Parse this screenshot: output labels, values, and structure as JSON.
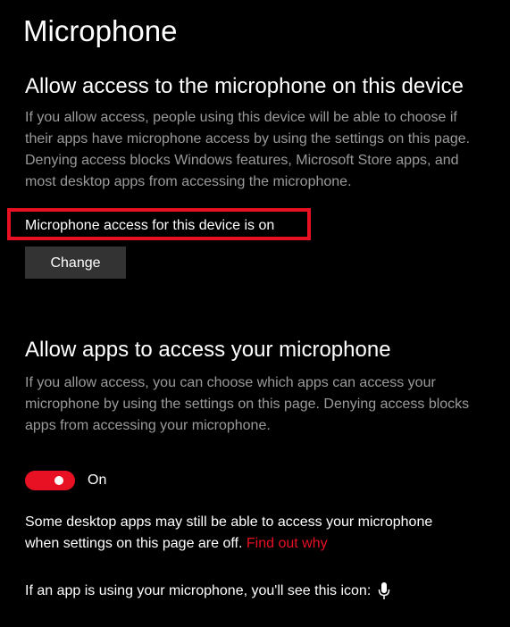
{
  "page": {
    "title": "Microphone"
  },
  "device_section": {
    "title": "Allow access to the microphone on this device",
    "description_lines": [
      "If you allow access, people using this device will be able to choose if",
      "their apps have microphone access by using the settings on this page.",
      "Denying access blocks Windows features, Microsoft Store apps, and",
      "most desktop apps from accessing the microphone."
    ],
    "status": "Microphone access for this device is on",
    "change_label": "Change"
  },
  "apps_section": {
    "title": "Allow apps to access your microphone",
    "description_lines": [
      "If you allow access, you can choose which apps can access your",
      "microphone by using the settings on this page. Denying access blocks",
      "apps from accessing your microphone."
    ],
    "toggle_state": "On",
    "note_line1": "Some desktop apps may still be able to access your microphone",
    "note_line2": "when settings on this page are off.",
    "find_out_link": "Find out why",
    "icon_note": "If an app is using your microphone, you'll see this icon:",
    "icon_name": "microphone-icon"
  },
  "colors": {
    "accent": "#e81123",
    "background": "#000000",
    "secondary_text": "#9a9a9a",
    "button_bg": "#333333"
  }
}
